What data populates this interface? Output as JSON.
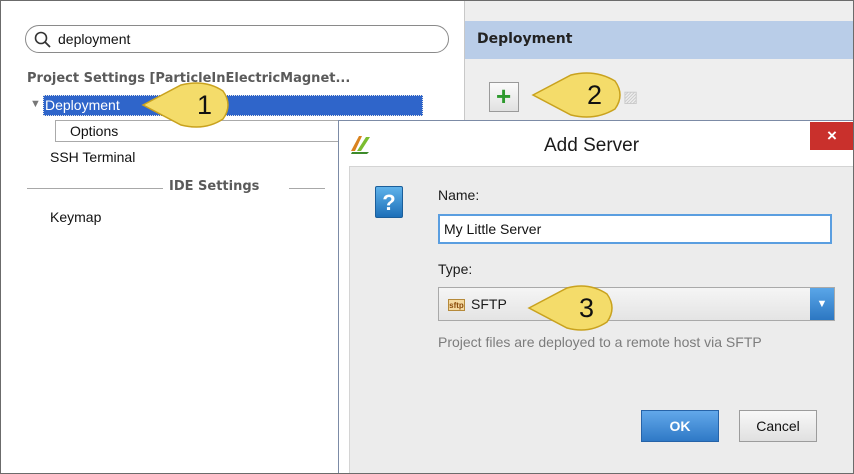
{
  "search": {
    "value": "deployment",
    "icon": "search-icon"
  },
  "tree": {
    "header": "Project Settings [ParticleInElectricMagnet...",
    "items": {
      "deployment": "Deployment",
      "options": "Options",
      "ssh": "SSH Terminal",
      "ide_settings": "IDE Settings",
      "keymap": "Keymap"
    }
  },
  "right_panel": {
    "title": "Deployment",
    "add_icon": "plus-icon"
  },
  "callouts": {
    "one": "1",
    "two": "2",
    "three": "3"
  },
  "dialog": {
    "title": "Add Server",
    "close_symbol": "×",
    "name_label": "Name:",
    "name_value": "My Little Server",
    "type_label": "Type:",
    "type_badge": "sftp",
    "type_value": "SFTP",
    "hint": "Project files are deployed to a remote host via SFTP",
    "ok": "OK",
    "cancel": "Cancel",
    "question_mark": "?"
  },
  "colors": {
    "selection": "#2f65ca",
    "header_bg": "#b9cde8",
    "callout_fill": "#f4dc6a",
    "close_red": "#c9302c",
    "primary_button": "#3a84cf"
  }
}
